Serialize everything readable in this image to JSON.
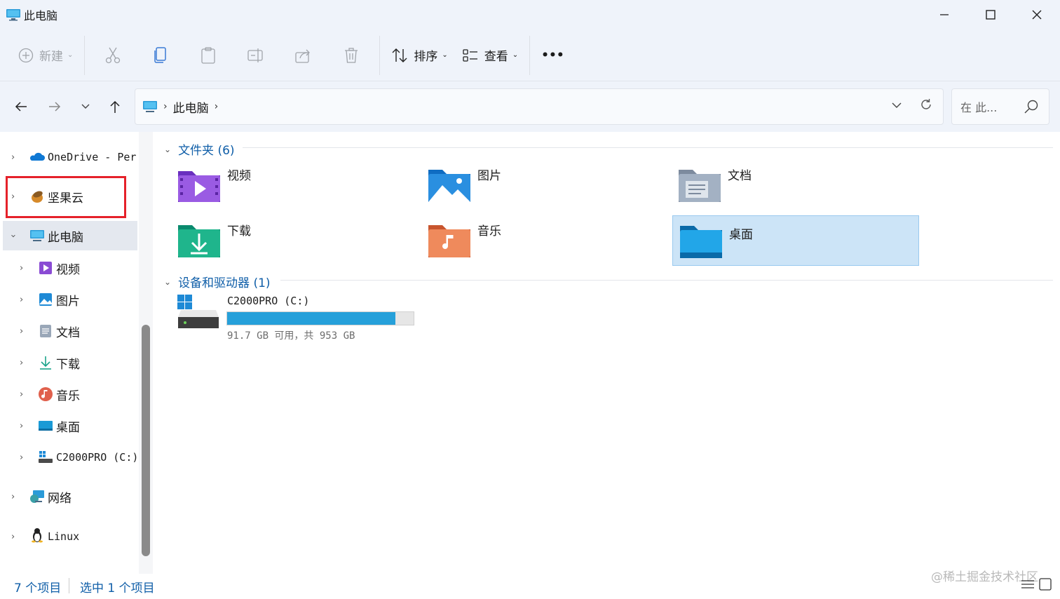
{
  "window": {
    "title": "此电脑"
  },
  "toolbar": {
    "new_label": "新建",
    "sort_label": "排序",
    "view_label": "查看",
    "more_label": "•••"
  },
  "address": {
    "crumb": "此电脑",
    "search_placeholder": "在 此..."
  },
  "sidebar": {
    "items": [
      {
        "label": "OneDrive - Per",
        "icon": "onedrive-icon"
      },
      {
        "label": "坚果云",
        "icon": "nutstore-icon"
      },
      {
        "label": "此电脑",
        "icon": "computer-icon"
      },
      {
        "label": "视频",
        "icon": "videos-icon"
      },
      {
        "label": "图片",
        "icon": "pictures-icon"
      },
      {
        "label": "文档",
        "icon": "documents-icon"
      },
      {
        "label": "下载",
        "icon": "downloads-icon"
      },
      {
        "label": "音乐",
        "icon": "music-icon"
      },
      {
        "label": "桌面",
        "icon": "desktop-icon"
      },
      {
        "label": "C2000PRO (C:)",
        "icon": "drive-icon"
      },
      {
        "label": "网络",
        "icon": "network-icon"
      },
      {
        "label": "Linux",
        "icon": "linux-icon"
      }
    ]
  },
  "main": {
    "folders_header": "文件夹 (6)",
    "folders": [
      {
        "label": "视频",
        "icon": "videos-folder-icon"
      },
      {
        "label": "图片",
        "icon": "pictures-folder-icon"
      },
      {
        "label": "文档",
        "icon": "documents-folder-icon"
      },
      {
        "label": "下载",
        "icon": "downloads-folder-icon"
      },
      {
        "label": "音乐",
        "icon": "music-folder-icon"
      },
      {
        "label": "桌面",
        "icon": "desktop-folder-icon"
      }
    ],
    "devices_header": "设备和驱动器 (1)",
    "drive": {
      "name": "C2000PRO (C:)",
      "info": "91.7 GB 可用，共 953 GB",
      "used_fraction": 0.904
    }
  },
  "status": {
    "item_count": "7 个项目",
    "selected": "选中 1 个项目"
  },
  "watermark": "@稀土掘金技术社区",
  "colors": {
    "accent": "#0f5ea8",
    "highlight_box": "#e5212a",
    "selection": "#cce4f7",
    "drive_fill": "#26a0da"
  }
}
